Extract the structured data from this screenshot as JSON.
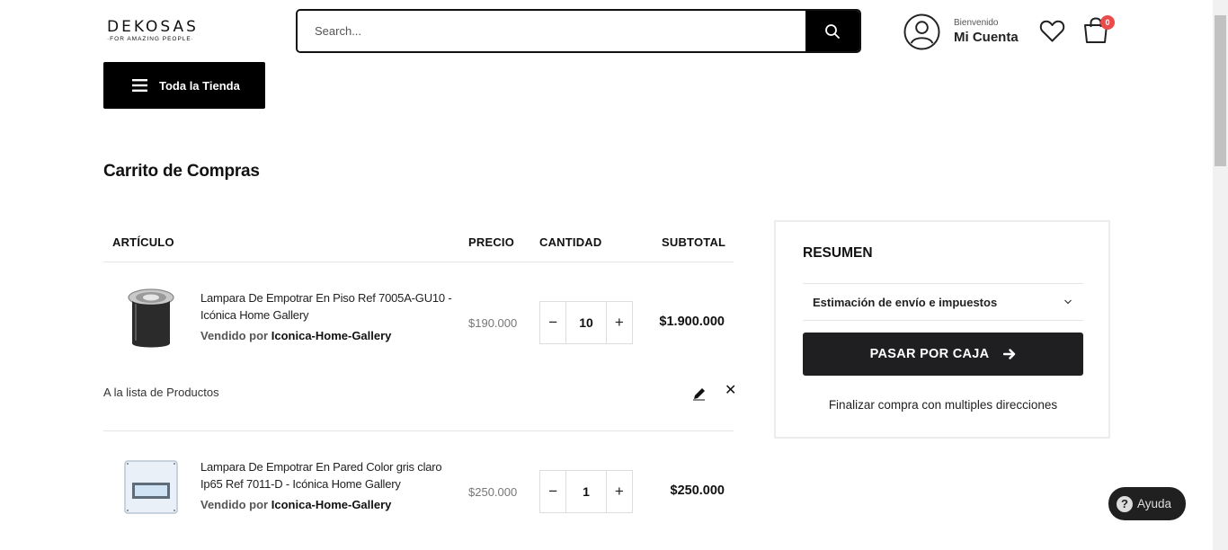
{
  "header": {
    "logo_main": "DEKOSAS",
    "logo_sub": "·FOR AMAZING PEOPLE·",
    "search_placeholder": "Search...",
    "welcome": "Bienvenido",
    "account": "Mi Cuenta",
    "cart_count": "0"
  },
  "nav": {
    "store_button": "Toda la Tienda"
  },
  "page": {
    "title": "Carrito de Compras"
  },
  "table": {
    "headers": {
      "item": "ARTÍCULO",
      "price": "PRECIO",
      "qty": "CANTIDAD",
      "subtotal": "SUBTOTAL"
    },
    "items": [
      {
        "name": "Lampara De Empotrar En Piso Ref 7005A-GU10 - Icónica Home Gallery",
        "seller_prefix": "Vendido por",
        "seller": "Iconica-Home-Gallery",
        "price": "$190.000",
        "qty": "10",
        "subtotal": "$1.900.000",
        "list_link": "A la lista de Productos"
      },
      {
        "name": "Lampara De Empotrar En Pared Color gris claro Ip65 Ref 7011-D - Icónica Home Gallery",
        "seller_prefix": "Vendido por",
        "seller": "Iconica-Home-Gallery",
        "price": "$250.000",
        "qty": "1",
        "subtotal": "$250.000"
      }
    ]
  },
  "summary": {
    "title": "RESUMEN",
    "shipping": "Estimación de envío e impuestos",
    "checkout": "PASAR POR CAJA",
    "multi": "Finalizar compra con multiples direcciones"
  },
  "help": {
    "label": "Ayuda"
  },
  "icons": [
    "search-icon",
    "user-icon",
    "heart-icon",
    "shopping-bag-icon",
    "menu-icon",
    "minus-icon",
    "plus-icon",
    "pencil-icon",
    "close-icon",
    "chevron-down-icon",
    "arrow-right-icon",
    "question-icon"
  ]
}
